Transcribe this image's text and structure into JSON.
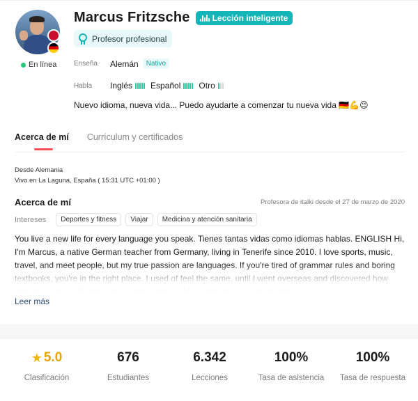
{
  "teacher": {
    "name": "Marcus Fritzsche",
    "smart_badge": "Lección inteligente",
    "pro_badge": "Profesor profesional",
    "online_status": "En línea",
    "teaches_label": "Enseña",
    "teaches_language": "Alemán",
    "native_tag": "Nativo",
    "speaks_label": "Habla",
    "speaks": [
      {
        "language": "Inglés",
        "level": 5
      },
      {
        "language": "Español",
        "level": 5
      },
      {
        "language": "Otro",
        "level": 1
      }
    ],
    "bio_line": "Nuevo idioma, nueva vida... Puedo ayudarte a comenzar tu nueva vida 🇩🇪💪😉"
  },
  "tabs": {
    "about": "Acerca de mí",
    "resume": "Currículum y certificados"
  },
  "details": {
    "from": "Desde  Alemania",
    "lives": "Vivo en La Laguna, España  ( 15:31 UTC +01:00 )",
    "about_title": "Acerca de mí",
    "teacher_since": "Profesora de italki desde el 27 de marzo de 2020",
    "interests_label": "Intereses",
    "interests": [
      "Deportes y fitness",
      "Viajar",
      "Medicina y atención sanitaria"
    ],
    "description": "You live a new life for every language you speak. Tienes tantas vidas como idiomas hablas. ENGLISH Hi, I'm Marcus, a native German teacher from Germany, living in Tenerife since 2010. I love sports, music, travel, and meet people, but my true passion are languages. If you're tired of grammar rules and boring textbooks, you're in the right place. I used of feel the same, until I went overseas and discovered how languages make life through communication. My approach is practical and focused on",
    "read_more": "Leer más"
  },
  "stats": [
    {
      "value": "5.0",
      "label": "Clasificación",
      "icon": "star-icon"
    },
    {
      "value": "676",
      "label": "Estudiantes"
    },
    {
      "value": "6.342",
      "label": "Lecciones"
    },
    {
      "value": "100%",
      "label": "Tasa de asistencia"
    },
    {
      "value": "100%",
      "label": "Tasa de respuesta"
    }
  ],
  "colors": {
    "accent_teal": "#13b5b8",
    "online_green": "#27c47a",
    "tab_underline": "#ff4d4f",
    "star": "#f5b800"
  }
}
